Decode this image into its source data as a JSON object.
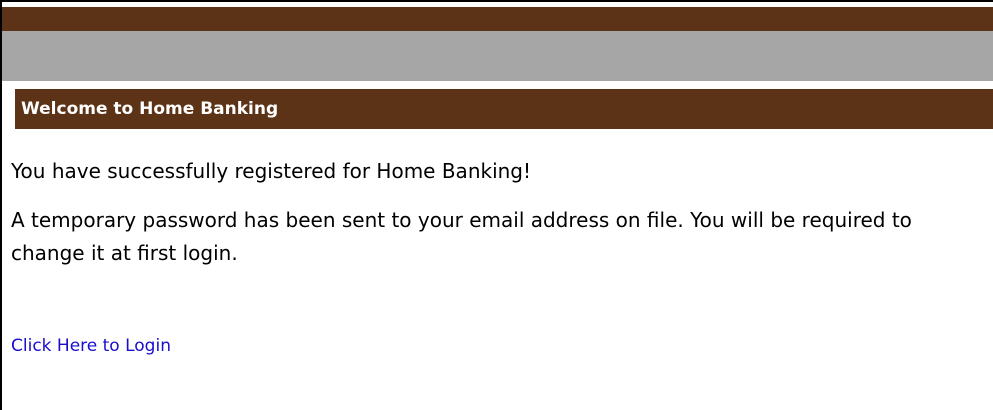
{
  "header": {
    "title": "Welcome to Home Banking"
  },
  "content": {
    "success_message": "You have successfully registered for Home Banking!",
    "temp_password_message": "A temporary password has been sent to your email address on file. You will be required to change it at first login."
  },
  "login_link": {
    "label": "Click Here to Login"
  },
  "colors": {
    "brand_brown": "#5c3317",
    "gray_band": "#a6a6a6",
    "link_blue": "#1a0dcc"
  }
}
